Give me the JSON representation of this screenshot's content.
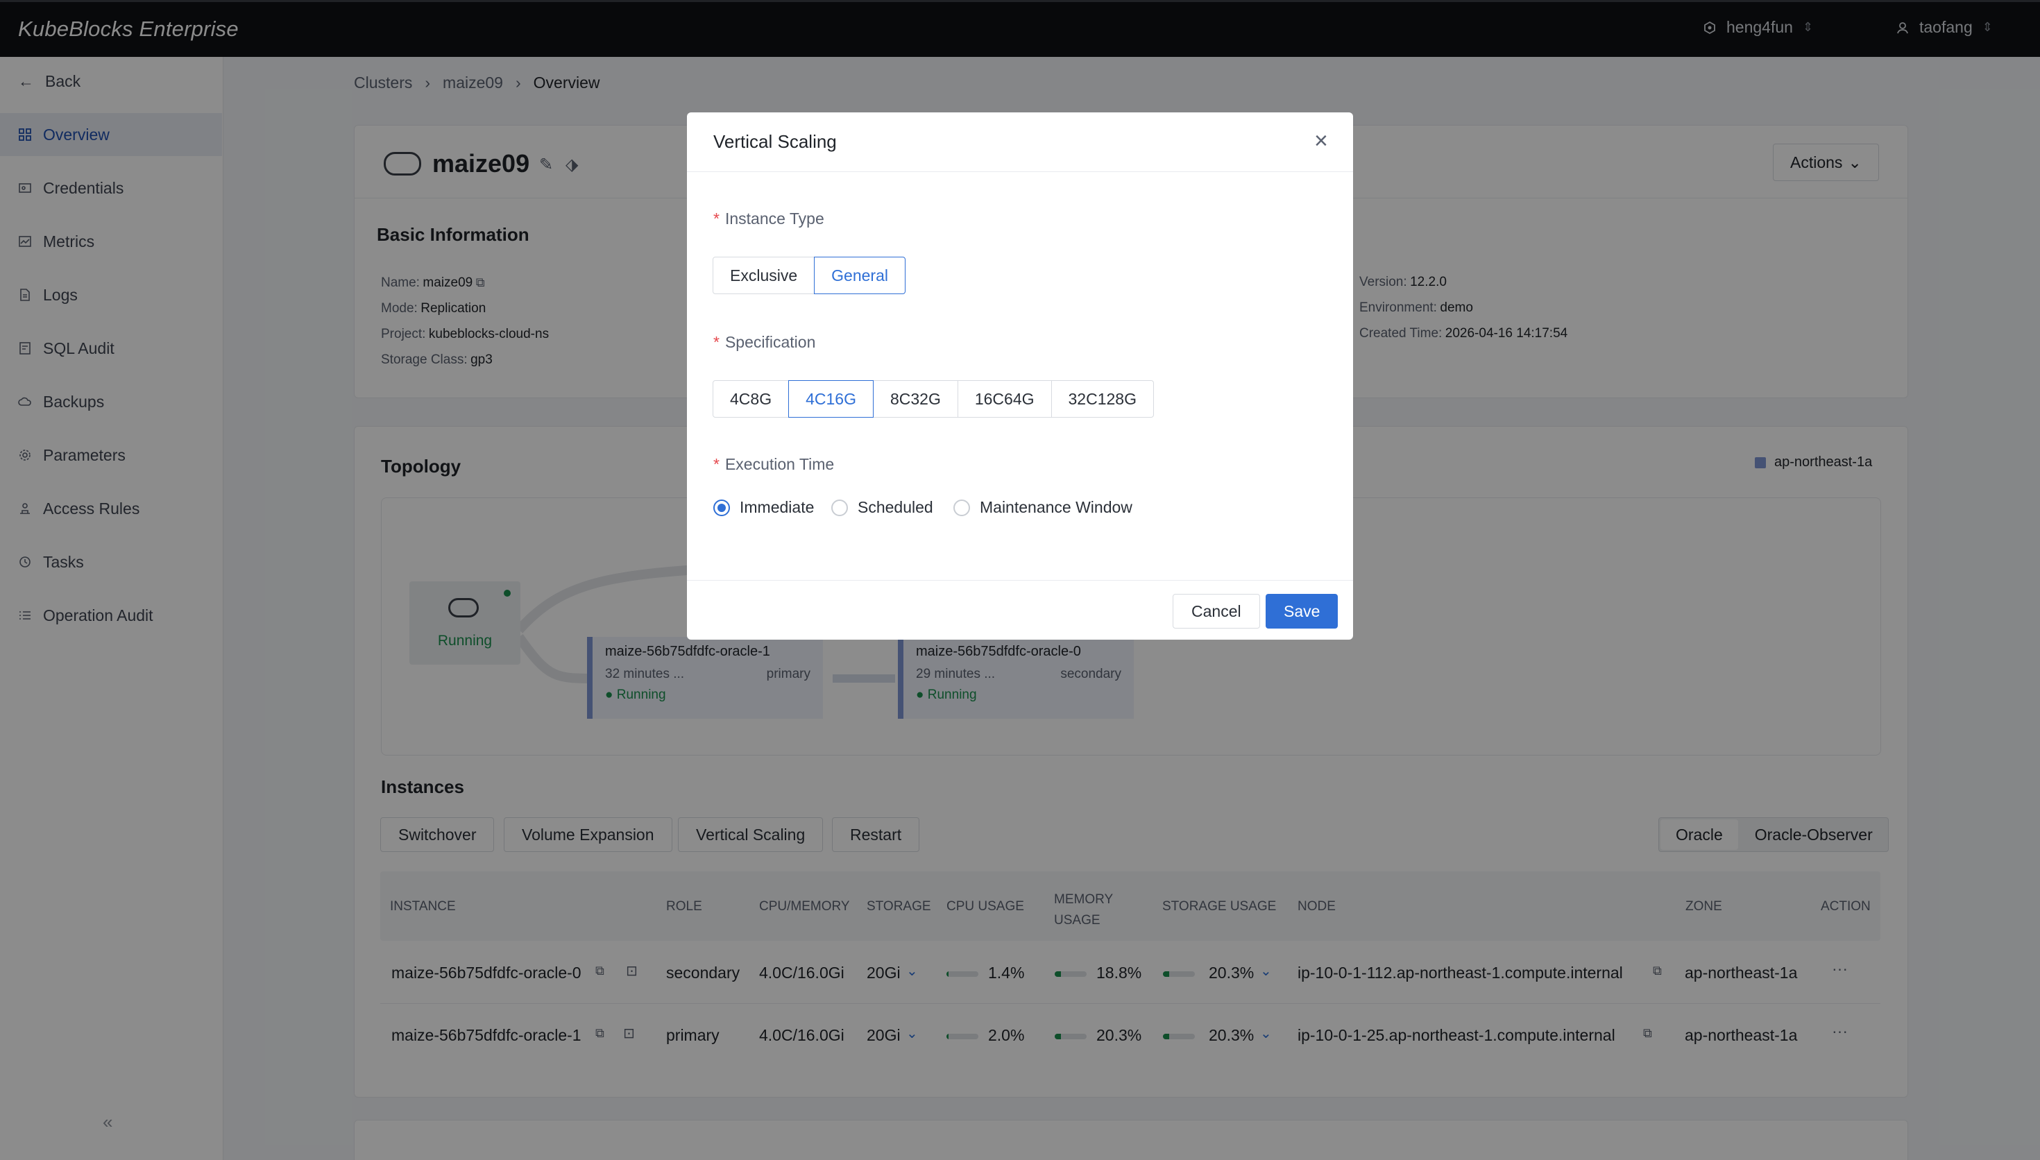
{
  "app": {
    "title": "KubeBlocks Enterprise",
    "org": "heng4fun",
    "user": "taofang"
  },
  "sidebar": {
    "back": "Back",
    "items": [
      {
        "label": "Overview",
        "icon": "grid-icon"
      },
      {
        "label": "Credentials",
        "icon": "key-icon"
      },
      {
        "label": "Metrics",
        "icon": "chart-icon"
      },
      {
        "label": "Logs",
        "icon": "file-icon"
      },
      {
        "label": "SQL Audit",
        "icon": "audit-icon"
      },
      {
        "label": "Backups",
        "icon": "cloud-icon"
      },
      {
        "label": "Parameters",
        "icon": "gear-icon"
      },
      {
        "label": "Access Rules",
        "icon": "access-icon"
      },
      {
        "label": "Tasks",
        "icon": "clock-icon"
      },
      {
        "label": "Operation Audit",
        "icon": "list-icon"
      }
    ]
  },
  "breadcrumb": [
    "Clusters",
    "maize09",
    "Overview"
  ],
  "cluster": {
    "name": "maize09",
    "actions": "Actions"
  },
  "basic": {
    "title": "Basic Information",
    "left": [
      [
        "Name:",
        "maize09"
      ],
      [
        "Mode:",
        "Replication"
      ],
      [
        "Project:",
        "kubeblocks-cloud-ns"
      ],
      [
        "Storage Class:",
        "gp3"
      ]
    ],
    "right": [
      [
        "Version:",
        "12.2.0"
      ],
      [
        "Environment:",
        "demo"
      ],
      [
        "Created Time:",
        "2026-04-16 14:17:54"
      ]
    ]
  },
  "topology": {
    "title": "Topology",
    "zone": "ap-northeast-1a",
    "status": "Running",
    "nodes": [
      {
        "name": "maize-56b75dfdfc-oracle-1",
        "age": "32 minutes ...",
        "role": "primary",
        "status": "Running"
      },
      {
        "name": "maize-56b75dfdfc-oracle-0",
        "age": "29 minutes ...",
        "role": "secondary",
        "status": "Running"
      }
    ]
  },
  "instances": {
    "title": "Instances",
    "buttons": [
      "Switchover",
      "Volume Expansion",
      "Vertical Scaling",
      "Restart"
    ],
    "tabs": [
      "Oracle",
      "Oracle-Observer"
    ],
    "headers": [
      "INSTANCE",
      "ROLE",
      "CPU/MEMORY",
      "STORAGE",
      "CPU USAGE",
      "MEMORY USAGE",
      "STORAGE USAGE",
      "NODE",
      "ZONE",
      "ACTION"
    ],
    "rows": [
      {
        "instance": "maize-56b75dfdfc-oracle-0",
        "role": "secondary",
        "cpumem": "4.0C/16.0Gi",
        "storage": "20Gi",
        "cpu": "1.4%",
        "mem": "18.8%",
        "stor": "20.3%",
        "node": "ip-10-0-1-112.ap-northeast-1.compute.internal",
        "zone": "ap-northeast-1a",
        "action": "···"
      },
      {
        "instance": "maize-56b75dfdfc-oracle-1",
        "role": "primary",
        "cpumem": "4.0C/16.0Gi",
        "storage": "20Gi",
        "cpu": "2.0%",
        "mem": "20.3%",
        "stor": "20.3%",
        "node": "ip-10-0-1-25.ap-northeast-1.compute.internal",
        "zone": "ap-northeast-1a",
        "action": "···"
      }
    ]
  },
  "modal": {
    "title": "Vertical Scaling",
    "instance_type": {
      "label": "Instance Type",
      "options": [
        "Exclusive",
        "General"
      ],
      "selected": "General"
    },
    "spec": {
      "label": "Specification",
      "options": [
        "4C8G",
        "4C16G",
        "8C32G",
        "16C64G",
        "32C128G"
      ],
      "selected": "4C16G"
    },
    "exec": {
      "label": "Execution Time",
      "options": [
        "Immediate",
        "Scheduled",
        "Maintenance Window"
      ],
      "selected": "Immediate"
    },
    "cancel": "Cancel",
    "save": "Save"
  }
}
